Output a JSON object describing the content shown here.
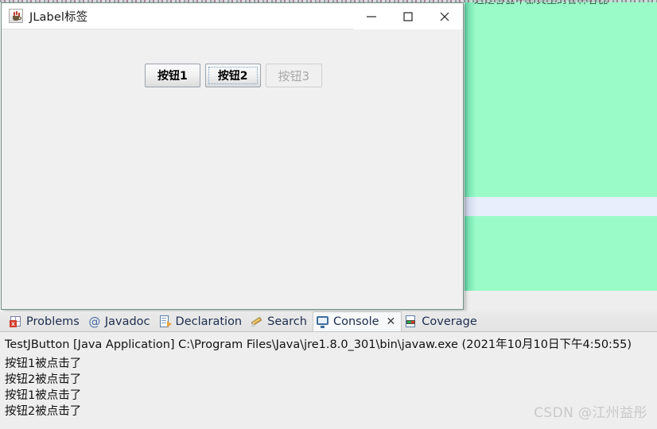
{
  "background": {
    "cut_off_text": "这是容器中部类型的各种容器",
    "green_panel_color": "#9afbc8",
    "band_color": "#e8eefb",
    "page_color": "#eeeeee"
  },
  "java_window": {
    "title": "JLabel标签",
    "icon": "java-cup-icon",
    "frame_bg": "#f0f0f0",
    "titlebar_bg": "#ffffff",
    "controls": [
      {
        "name": "minimize",
        "glyph": "minimize-icon"
      },
      {
        "name": "maximize",
        "glyph": "maximize-icon"
      },
      {
        "name": "close",
        "glyph": "close-icon"
      }
    ],
    "buttons": [
      {
        "label": "按钮1",
        "state": "enabled",
        "focused": false
      },
      {
        "label": "按钮2",
        "state": "enabled",
        "focused": true
      },
      {
        "label": "按钮3",
        "state": "disabled",
        "focused": false
      }
    ]
  },
  "ide": {
    "tabs": [
      {
        "label": "Problems",
        "icon": "problems-icon",
        "active": false,
        "closable": false
      },
      {
        "label": "Javadoc",
        "icon": "javadoc-at-icon",
        "active": false,
        "closable": false
      },
      {
        "label": "Declaration",
        "icon": "declaration-icon",
        "active": false,
        "closable": false
      },
      {
        "label": "Search",
        "icon": "search-pencil-icon",
        "active": false,
        "closable": false
      },
      {
        "label": "Console",
        "icon": "console-monitor-icon",
        "active": true,
        "closable": true,
        "close_glyph": "✕"
      },
      {
        "label": "Coverage",
        "icon": "coverage-icon",
        "active": false,
        "closable": false
      }
    ],
    "launch_config": "TestJButton [Java Application] C:\\Program Files\\Java\\jre1.8.0_301\\bin\\javaw.exe  (2021年10月10日下午4:50:55)",
    "console_output": [
      "按钮1被点击了",
      "按钮2被点击了",
      "按钮1被点击了",
      "按钮2被点击了"
    ]
  },
  "watermark": "CSDN @江州益彤"
}
